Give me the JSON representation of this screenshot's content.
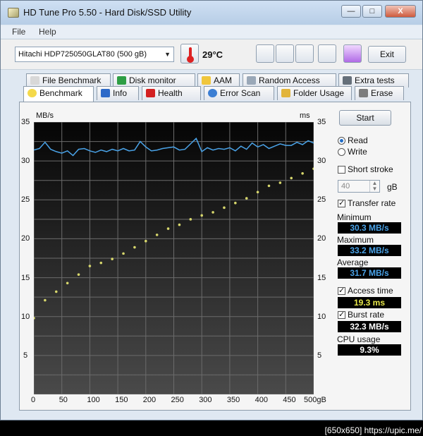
{
  "window": {
    "title": "HD Tune Pro 5.50 - Hard Disk/SSD Utility",
    "minimize": "—",
    "maximize": "□",
    "close": "X"
  },
  "menu": [
    {
      "label": "File"
    },
    {
      "label": "Help"
    }
  ],
  "toolbar": {
    "drive": "Hitachi HDP725050GLAT80 (500 gB)",
    "temperature": "29°C",
    "exit_label": "Exit",
    "icons": [
      "copy-icon",
      "copy-all-icon",
      "camera-icon",
      "wrench-icon",
      "download-icon"
    ]
  },
  "tabs_top": [
    "File Benchmark",
    "Disk monitor",
    "AAM",
    "Random Access",
    "Extra tests"
  ],
  "tabs_bottom": [
    "Benchmark",
    "Info",
    "Health",
    "Error Scan",
    "Folder Usage",
    "Erase"
  ],
  "chart_data": {
    "type": "line",
    "title": "",
    "left_axis_label": "MB/s",
    "right_axis_label": "ms",
    "x_unit": "gB",
    "x_ticks": [
      "0",
      "50",
      "100",
      "150",
      "200",
      "250",
      "300",
      "350",
      "400",
      "450",
      "500gB"
    ],
    "y_ticks_left": [
      "5",
      "10",
      "15",
      "20",
      "25",
      "30",
      "35"
    ],
    "y_ticks_right": [
      "5",
      "10",
      "15",
      "20",
      "25",
      "30",
      "35"
    ],
    "xlim": [
      0,
      500
    ],
    "ylim": [
      0,
      35
    ],
    "grid": true,
    "series": [
      {
        "name": "Transfer rate",
        "color": "#4aa3e8",
        "x": [
          0,
          10,
          20,
          30,
          40,
          50,
          60,
          70,
          80,
          90,
          100,
          110,
          120,
          130,
          140,
          150,
          160,
          170,
          180,
          190,
          200,
          210,
          220,
          230,
          240,
          250,
          260,
          270,
          280,
          290,
          300,
          310,
          320,
          330,
          340,
          350,
          360,
          370,
          380,
          390,
          400,
          410,
          420,
          430,
          440,
          450,
          460,
          470,
          480,
          490,
          500
        ],
        "y": [
          31.4,
          31.6,
          32.4,
          31.5,
          31.2,
          31.0,
          31.3,
          30.7,
          31.5,
          31.6,
          31.3,
          31.1,
          31.4,
          31.2,
          31.5,
          31.3,
          31.6,
          31.3,
          31.4,
          32.5,
          31.8,
          31.3,
          31.4,
          31.6,
          31.7,
          31.8,
          31.4,
          31.5,
          32.2,
          32.9,
          31.2,
          31.7,
          31.4,
          31.6,
          31.5,
          31.7,
          31.3,
          31.9,
          31.5,
          32.3,
          31.8,
          32.1,
          31.6,
          31.9,
          32.2,
          32.0,
          32.0,
          32.4,
          32.1,
          32.6,
          32.3
        ]
      },
      {
        "name": "Access time",
        "color": "#d7d76c",
        "x": [
          0,
          20,
          40,
          60,
          80,
          100,
          120,
          140,
          160,
          180,
          200,
          220,
          240,
          260,
          280,
          300,
          320,
          340,
          360,
          380,
          400,
          420,
          440,
          460,
          480,
          500
        ],
        "y": [
          9.8,
          12.1,
          13.2,
          14.3,
          15.4,
          16.5,
          16.9,
          17.4,
          18.1,
          18.9,
          19.7,
          20.5,
          21.3,
          21.8,
          22.5,
          23.0,
          23.4,
          24.0,
          24.6,
          25.2,
          26.0,
          26.8,
          27.2,
          27.8,
          28.4,
          29.0
        ]
      }
    ]
  },
  "right_panel": {
    "start_label": "Start",
    "read_label": "Read",
    "write_label": "Write",
    "short_stroke_label": "Short stroke",
    "short_stroke_value": "40",
    "short_stroke_unit": "gB",
    "transfer_rate_label": "Transfer rate",
    "minimum_label": "Minimum",
    "minimum_value": "30.3 MB/s",
    "maximum_label": "Maximum",
    "maximum_value": "33.2 MB/s",
    "average_label": "Average",
    "average_value": "31.7 MB/s",
    "access_time_label": "Access time",
    "access_time_value": "19.3 ms",
    "burst_rate_label": "Burst rate",
    "burst_rate_value": "32.3 MB/s",
    "cpu_usage_label": "CPU usage",
    "cpu_usage_value": "9.3%"
  },
  "footer": "[650x650] https://upic.me/"
}
